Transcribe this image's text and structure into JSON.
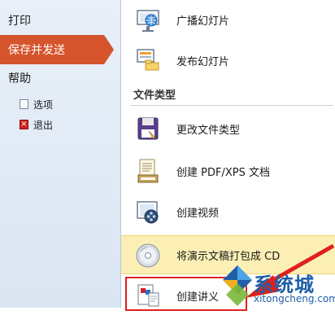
{
  "sidebar": {
    "items": [
      {
        "label": "打印"
      },
      {
        "label": "保存并发送"
      },
      {
        "label": "帮助"
      }
    ],
    "subitems": [
      {
        "label": "选项",
        "icon": "options-doc-icon"
      },
      {
        "label": "退出",
        "icon": "exit-x-icon"
      }
    ]
  },
  "main": {
    "items": [
      {
        "label": "广播幻灯片",
        "icon": "broadcast-slideshow-icon"
      },
      {
        "label": "发布幻灯片",
        "icon": "publish-slides-icon"
      }
    ],
    "section_title": "文件类型",
    "filetypes": [
      {
        "label": "更改文件类型",
        "icon": "change-filetype-icon"
      },
      {
        "label": "创建 PDF/XPS 文档",
        "icon": "pdf-xps-icon"
      },
      {
        "label": "创建视频",
        "icon": "create-video-icon"
      },
      {
        "label": "将演示文稿打包成 CD",
        "icon": "cd-package-icon",
        "highlighted": true
      },
      {
        "label": "创建讲义",
        "icon": "handout-icon"
      }
    ]
  },
  "watermark": {
    "text": "系统城",
    "url": "xitongcheng.com"
  },
  "colors": {
    "accent": "#d6542c",
    "highlight": "#fcefb5",
    "annotation": "#e0201c",
    "watermark": "#1f5fa8"
  }
}
